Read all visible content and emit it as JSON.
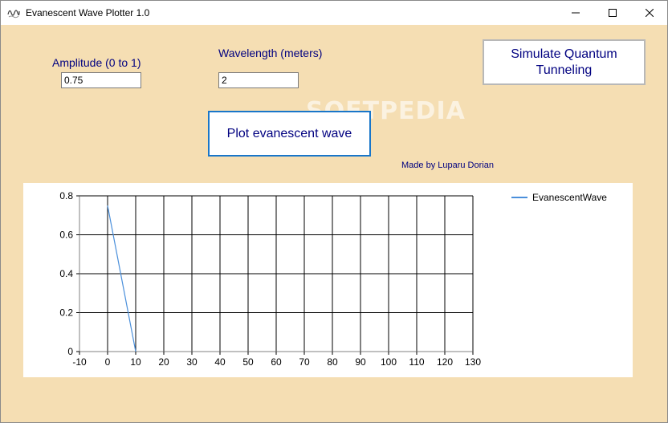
{
  "window": {
    "title": "Evanescent Wave Plotter 1.0",
    "icon": "wave-app-icon",
    "controls": [
      "minimize",
      "maximize",
      "close"
    ]
  },
  "form": {
    "amplitude_label": "Amplitude (0 to 1)",
    "amplitude_value": "0.75",
    "wavelength_label": "Wavelength (meters)",
    "wavelength_value": "2",
    "plot_button": "Plot evanescent wave",
    "simulate_button_line1": "Simulate Quantum",
    "simulate_button_line2": "Tunneling",
    "credit": "Made by Luparu Dorian",
    "watermark": "SOFTPEDIA"
  },
  "colors": {
    "background": "#f5deb3",
    "label_text": "#000080",
    "series_line": "#4a8fdb",
    "plot_button_border": "#1976c9"
  },
  "chart_data": {
    "type": "line",
    "title": "",
    "xlabel": "",
    "ylabel": "",
    "xlim": [
      -10,
      130
    ],
    "ylim": [
      0,
      0.8
    ],
    "x_ticks": [
      -10,
      0,
      10,
      20,
      30,
      40,
      50,
      60,
      70,
      80,
      90,
      100,
      110,
      120,
      130
    ],
    "y_ticks": [
      0,
      0.2,
      0.4,
      0.6,
      0.8
    ],
    "y_tick_labels": [
      "0",
      "0.2",
      "0.4",
      "0.6",
      "0.8"
    ],
    "grid": true,
    "legend_position": "top-right",
    "series": [
      {
        "name": "EvanescentWave",
        "x": [
          0,
          2,
          4,
          6,
          8,
          10
        ],
        "y": [
          0.75,
          0.6,
          0.45,
          0.3,
          0.15,
          0
        ]
      }
    ]
  }
}
